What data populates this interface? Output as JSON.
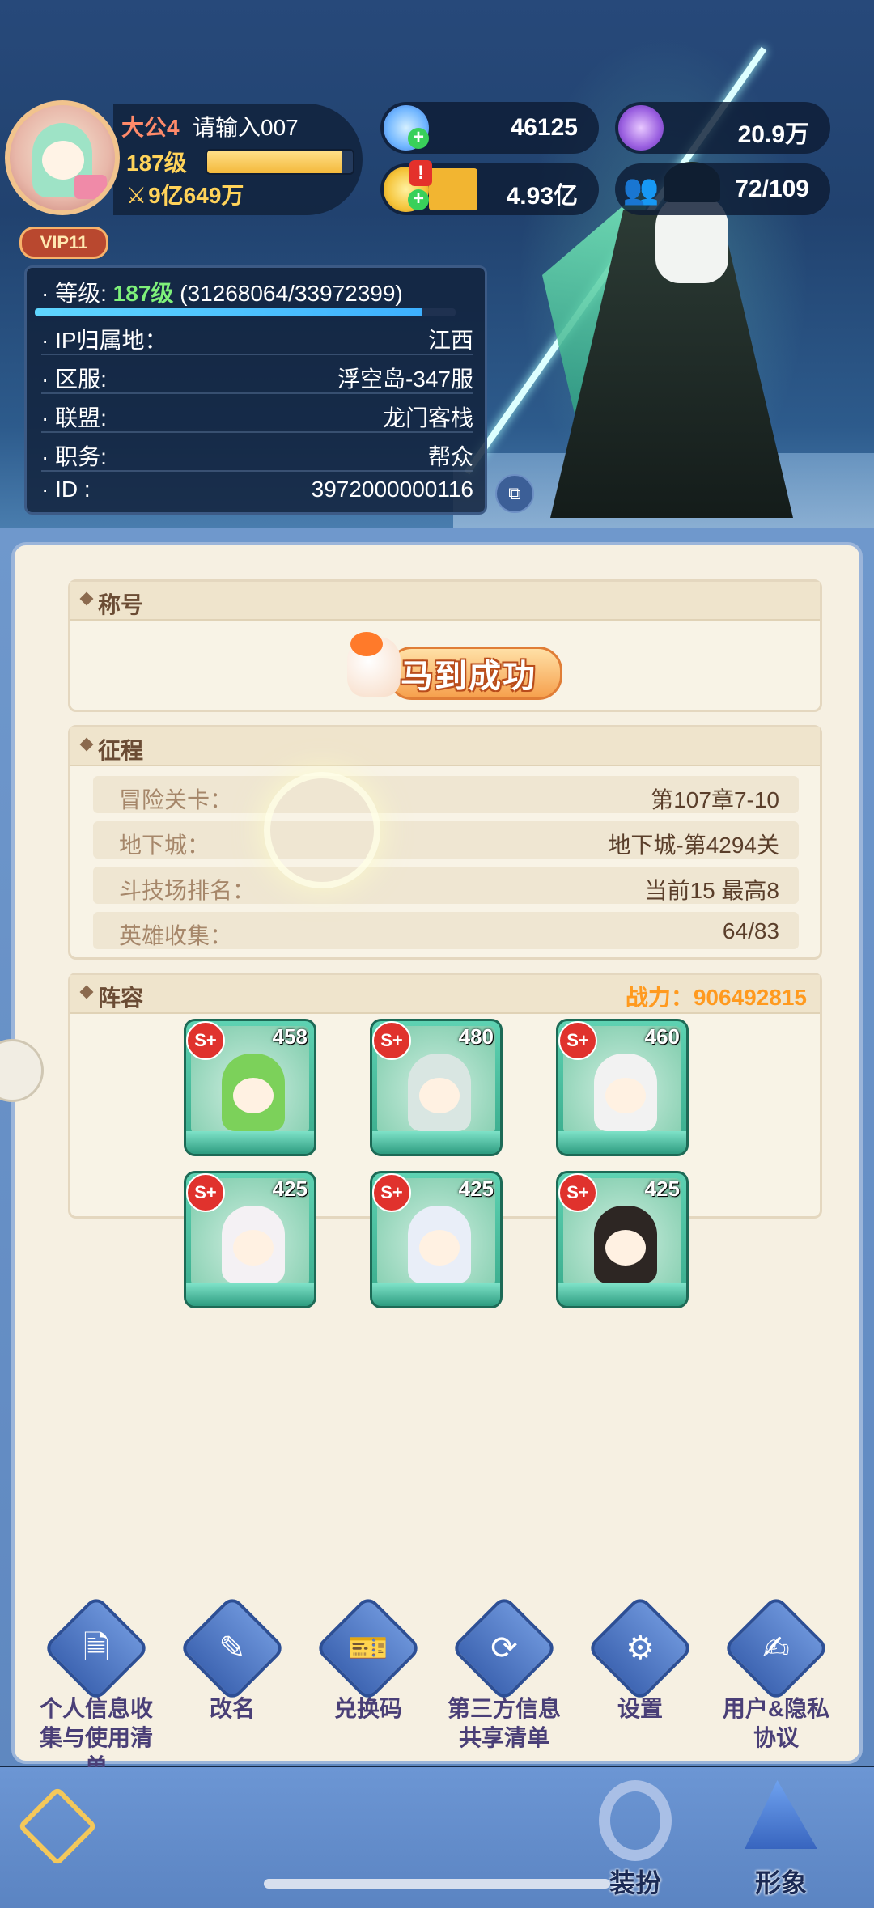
{
  "profile": {
    "name_prefix": "大公4",
    "name": "请输入007",
    "level": "187级",
    "xp_fraction": 0.92,
    "power": "9亿649万",
    "vip": "VIP11"
  },
  "currencies": {
    "stars": "46125",
    "gems": "20.9万",
    "gold": "4.93亿",
    "friends": "72/109"
  },
  "info": {
    "level_label": "等级:",
    "level_value": "187级",
    "level_progress": "(31268064/33972399)",
    "level_fraction": 0.92,
    "rows": [
      {
        "label": "IP归属地：",
        "value": "江西"
      },
      {
        "label": "区服:",
        "value": "浮空岛-347服"
      },
      {
        "label": "联盟:",
        "value": "龙门客栈"
      },
      {
        "label": "职务:",
        "value": "帮众"
      },
      {
        "label": "ID :",
        "value": "3972000000116"
      }
    ]
  },
  "title_section": {
    "header": "称号",
    "title_text": "马到成功"
  },
  "journey": {
    "header": "征程",
    "rows": [
      {
        "label": "冒险关卡：",
        "value": "第107章7-10"
      },
      {
        "label": "地下城：",
        "value": "地下城-第4294关"
      },
      {
        "label": "斗技场排名：",
        "value": "当前15 最高8"
      },
      {
        "label": "英雄收集：",
        "value": "64/83"
      }
    ]
  },
  "lineup": {
    "header": "阵容",
    "power_label": "战力：906492815",
    "heroes": [
      {
        "rank": "S+",
        "level": "458",
        "hair": "#7cd15a"
      },
      {
        "rank": "S+",
        "level": "480",
        "hair": "#d9e6e2"
      },
      {
        "rank": "S+",
        "level": "460",
        "hair": "#f2f2f2"
      },
      {
        "rank": "S+",
        "level": "425",
        "hair": "#f4f1f4"
      },
      {
        "rank": "S+",
        "level": "425",
        "hair": "#e9eef8"
      },
      {
        "rank": "S+",
        "level": "425",
        "hair": "#2d2623"
      }
    ]
  },
  "actions": [
    {
      "label": "个人信息收集与使用清单",
      "icon": "document-search-icon"
    },
    {
      "label": "改名",
      "icon": "edit-icon"
    },
    {
      "label": "兑换码",
      "icon": "ticket-icon"
    },
    {
      "label": "第三方信息共享清单",
      "icon": "share-list-icon"
    },
    {
      "label": "设置",
      "icon": "gear-icon"
    },
    {
      "label": "用户&隐私协议",
      "icon": "agreement-icon"
    }
  ],
  "bottom_tabs": {
    "dress": "装扮",
    "appearance": "形象"
  }
}
